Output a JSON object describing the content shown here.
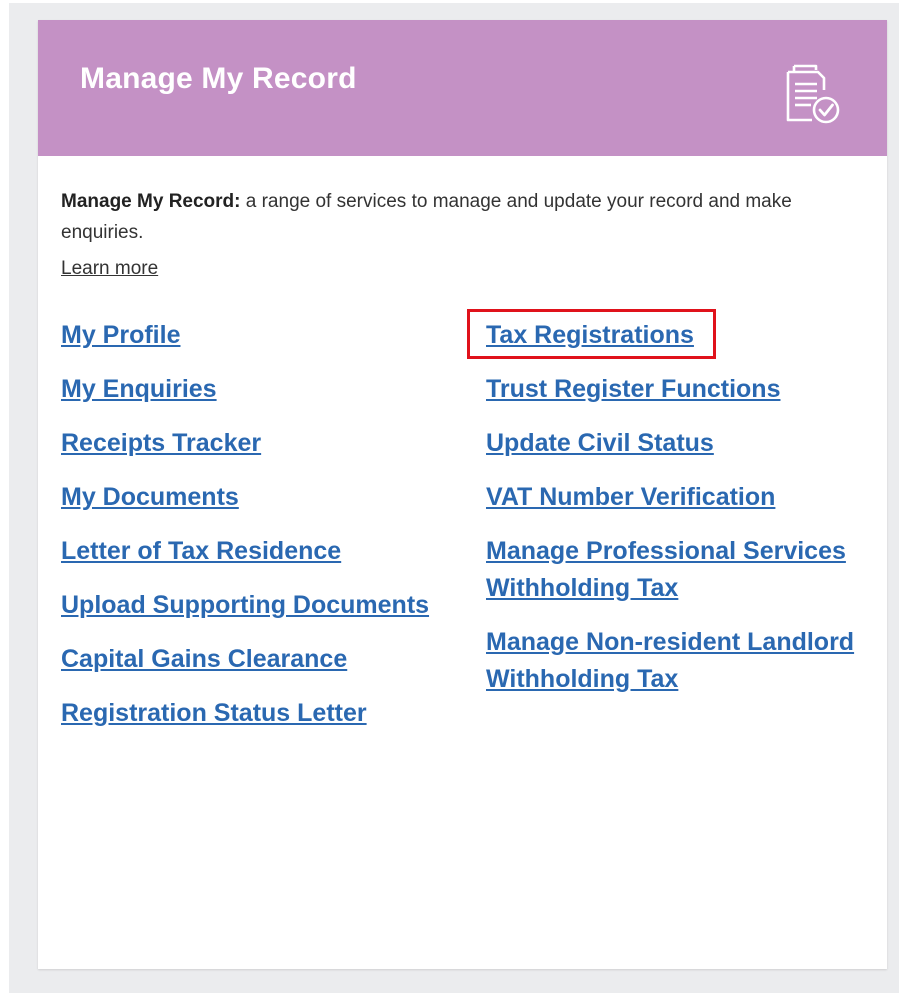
{
  "panel": {
    "title": "Manage My Record",
    "header_color": "#c491c5",
    "header_icon": "document-check-icon"
  },
  "description": {
    "bold": "Manage My Record:",
    "text": " a range of services to manage and update your record and make enquiries."
  },
  "learn_more_label": "Learn more",
  "links": {
    "left": [
      "My Profile",
      "My Enquiries",
      "Receipts Tracker",
      "My Documents",
      "Letter of Tax Residence",
      "Upload Supporting Documents",
      "Capital Gains Clearance",
      "Registration Status Letter"
    ],
    "right": [
      "Tax Registrations",
      "Trust Register Functions",
      "Update Civil Status",
      "VAT Number Verification",
      "Manage Professional Services Withholding Tax",
      "Manage Non-resident Landlord Withholding Tax"
    ]
  },
  "link_color": "#2a68b1",
  "highlight_color": "#e0121b",
  "highlighted_link": "Tax Registrations"
}
